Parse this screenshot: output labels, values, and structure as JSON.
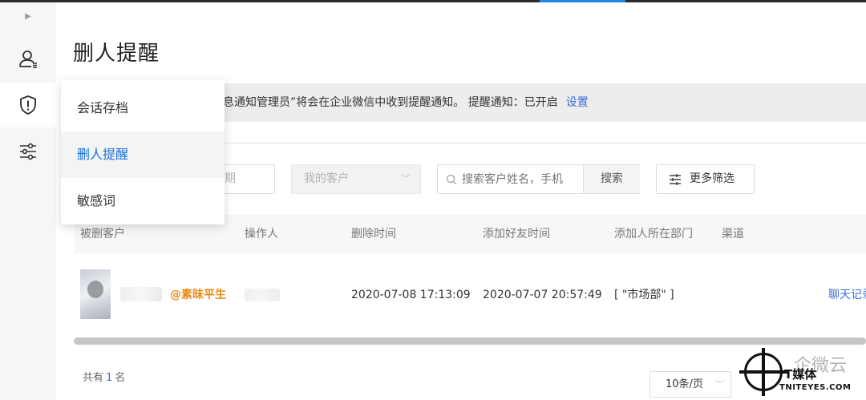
{
  "page": {
    "title": "删人提醒"
  },
  "notice": {
    "text": "息通知管理员”将会在企业微信中收到提醒通知。 提醒通知：已开启",
    "link": "设置"
  },
  "sidebar": {
    "items": [
      {
        "icon": "user-icon"
      },
      {
        "icon": "shield-alert-icon",
        "active": true
      },
      {
        "icon": "sliders-icon"
      }
    ]
  },
  "dropdown": {
    "items": [
      {
        "label": "会话存档"
      },
      {
        "label": "删人提醒",
        "active": true
      },
      {
        "label": "敏感词"
      }
    ]
  },
  "filters": {
    "date_placeholder": "期",
    "select_value": "我的客户",
    "search_placeholder": "搜索客户姓名，手机",
    "search_button": "搜索",
    "more_filter": "更多筛选"
  },
  "table": {
    "columns": [
      "被删客户",
      "操作人",
      "删除时间",
      "添加好友时间",
      "添加人所在部门",
      "渠道"
    ],
    "rows": [
      {
        "customer_tag": "@素昧平生",
        "delete_time": "2020-07-08 17:13:09",
        "add_time": "2020-07-07 20:57:49",
        "department": "[ \"市场部\" ]",
        "action": "聊天记录"
      }
    ]
  },
  "footer": {
    "total_prefix": "共有",
    "total_count": "1",
    "total_suffix": "名",
    "page_size": "10条/页"
  },
  "watermark": {
    "big": "企微云",
    "main": "T媒体",
    "sub": "TNITEYES.COM"
  },
  "colors": {
    "accent": "#1a6fe0",
    "link": "#3a6fd8",
    "tag_orange": "#e88a1a",
    "sidebar_bg": "#f6f6f6"
  }
}
